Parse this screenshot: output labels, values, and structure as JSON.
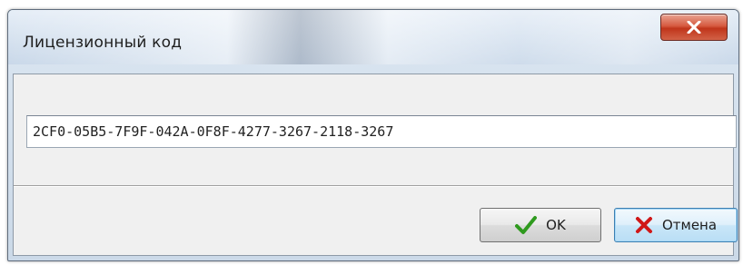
{
  "window": {
    "title": "Лицензионный код",
    "close_icon": "close-x-icon"
  },
  "license": {
    "key_value": "2CF0-05B5-7F9F-042A-0F8F-4277-3267-2118-3267"
  },
  "buttons": {
    "ok_label": "OK",
    "ok_icon": "green-checkmark-icon",
    "cancel_label": "Отмена",
    "cancel_icon": "red-cross-icon"
  },
  "colors": {
    "ok_icon": "#2f9a1e",
    "cancel_icon": "#d01818",
    "close_button": "#c9432b"
  }
}
